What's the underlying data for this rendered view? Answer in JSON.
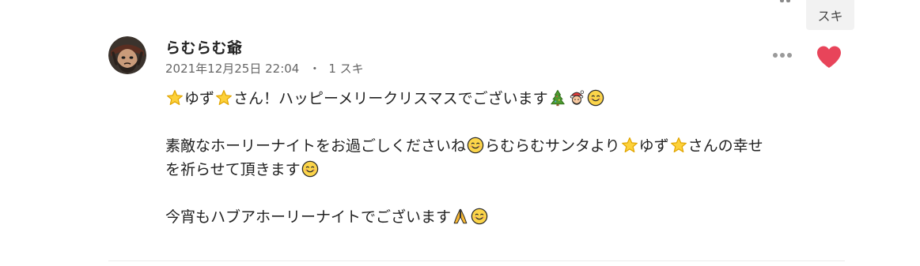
{
  "previous_comment": {
    "like_label": "スキ"
  },
  "comment": {
    "author": "らむらむ爺",
    "date": "2021年12月25日 22:04",
    "meta_separator": "・",
    "like_count": "1 スキ",
    "liked": true,
    "heart_color": "#e8445a",
    "icons": {
      "more": "more-horizontal-icon",
      "like": "heart-icon"
    },
    "body": {
      "line1": {
        "t1": "ゆず",
        "t2": "さん！ハッピーメリークリスマスでございます"
      },
      "line2": {
        "t1": "素敵なホーリーナイトをお過ごしくださいね",
        "t2": "らむらむサンタより",
        "t3": "ゆず",
        "t4": "さんの幸せ"
      },
      "line3": {
        "t1": "を祈らせて頂きます"
      },
      "line4": {
        "t1": "今宵もハブアホーリーナイトでございます"
      }
    }
  }
}
